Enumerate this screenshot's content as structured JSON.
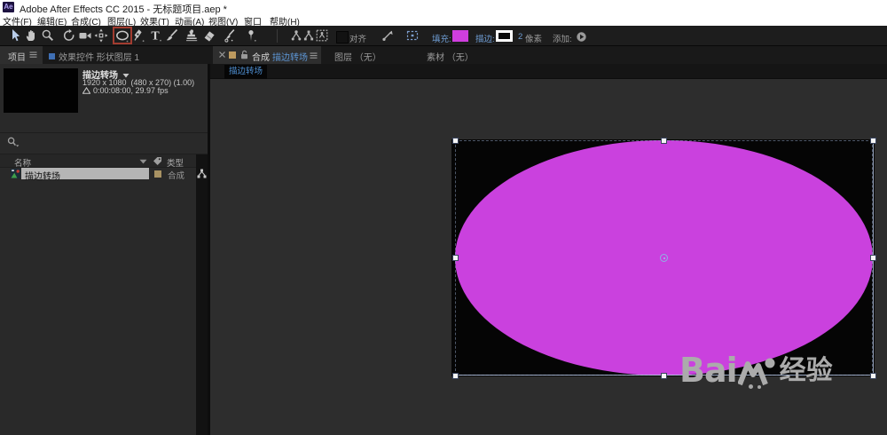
{
  "window": {
    "app_icon": "Ae",
    "title": "Adobe After Effects CC 2015 - 无标题项目.aep *"
  },
  "menu": {
    "items": [
      {
        "label": "文件(F)"
      },
      {
        "label": "编辑(E)"
      },
      {
        "label": "合成(C)"
      },
      {
        "label": "图层(L)"
      },
      {
        "label": "效果(T)"
      },
      {
        "label": "动画(A)"
      },
      {
        "label": "视图(V)"
      },
      {
        "label": "窗口"
      },
      {
        "label": "帮助(H)"
      }
    ]
  },
  "toolbar": {
    "tools": [
      {
        "name": "selection",
        "active": true
      },
      {
        "name": "hand"
      },
      {
        "name": "zoom"
      },
      {
        "name": "rotate"
      },
      {
        "name": "unified-camera"
      },
      {
        "name": "pan-behind"
      },
      {
        "name": "ellipse",
        "boxed": true
      },
      {
        "name": "pen"
      },
      {
        "name": "type"
      },
      {
        "name": "brush"
      },
      {
        "name": "clone-stamp"
      },
      {
        "name": "eraser"
      },
      {
        "name": "roto-brush"
      },
      {
        "name": "puppet-pin"
      },
      {
        "name": "axis-local"
      },
      {
        "name": "axis-world"
      },
      {
        "name": "axis-view"
      }
    ],
    "snap_label": "对齐",
    "fill_label": "填充:",
    "fill_color": "#cf3ede",
    "stroke_label": "描边:",
    "stroke_color": "#ffffff",
    "stroke_width": "2",
    "stroke_unit": "像素",
    "add_label": "添加:"
  },
  "project_panel": {
    "tabs": [
      {
        "label": "项目",
        "active": true
      },
      {
        "label": "效果控件 形状图层 1",
        "active": false
      }
    ],
    "preview": {
      "comp_name": "描边转场",
      "dimensions": "1920 x 1080  (480 x 270) (1.00)",
      "duration": "0:00:08:00, 29.97 fps"
    },
    "columns": {
      "name": "名称",
      "type": "类型"
    },
    "rows": [
      {
        "name": "描边转场",
        "type": "合成",
        "label_color": "#a89263",
        "selected": true
      }
    ]
  },
  "viewer": {
    "tabs": [
      {
        "panel": "合成",
        "comp": "描边转场",
        "active": true
      },
      {
        "label": "图层 （无）"
      },
      {
        "label": "素材 （无）"
      }
    ],
    "comp_tabs": [
      {
        "label": "描边转场",
        "active": true
      }
    ],
    "canvas": {
      "background": "#050505",
      "shape": "ellipse",
      "fill_color": "#ca41de"
    },
    "watermark": {
      "latin": "Bai",
      "cjk": "经验"
    }
  }
}
